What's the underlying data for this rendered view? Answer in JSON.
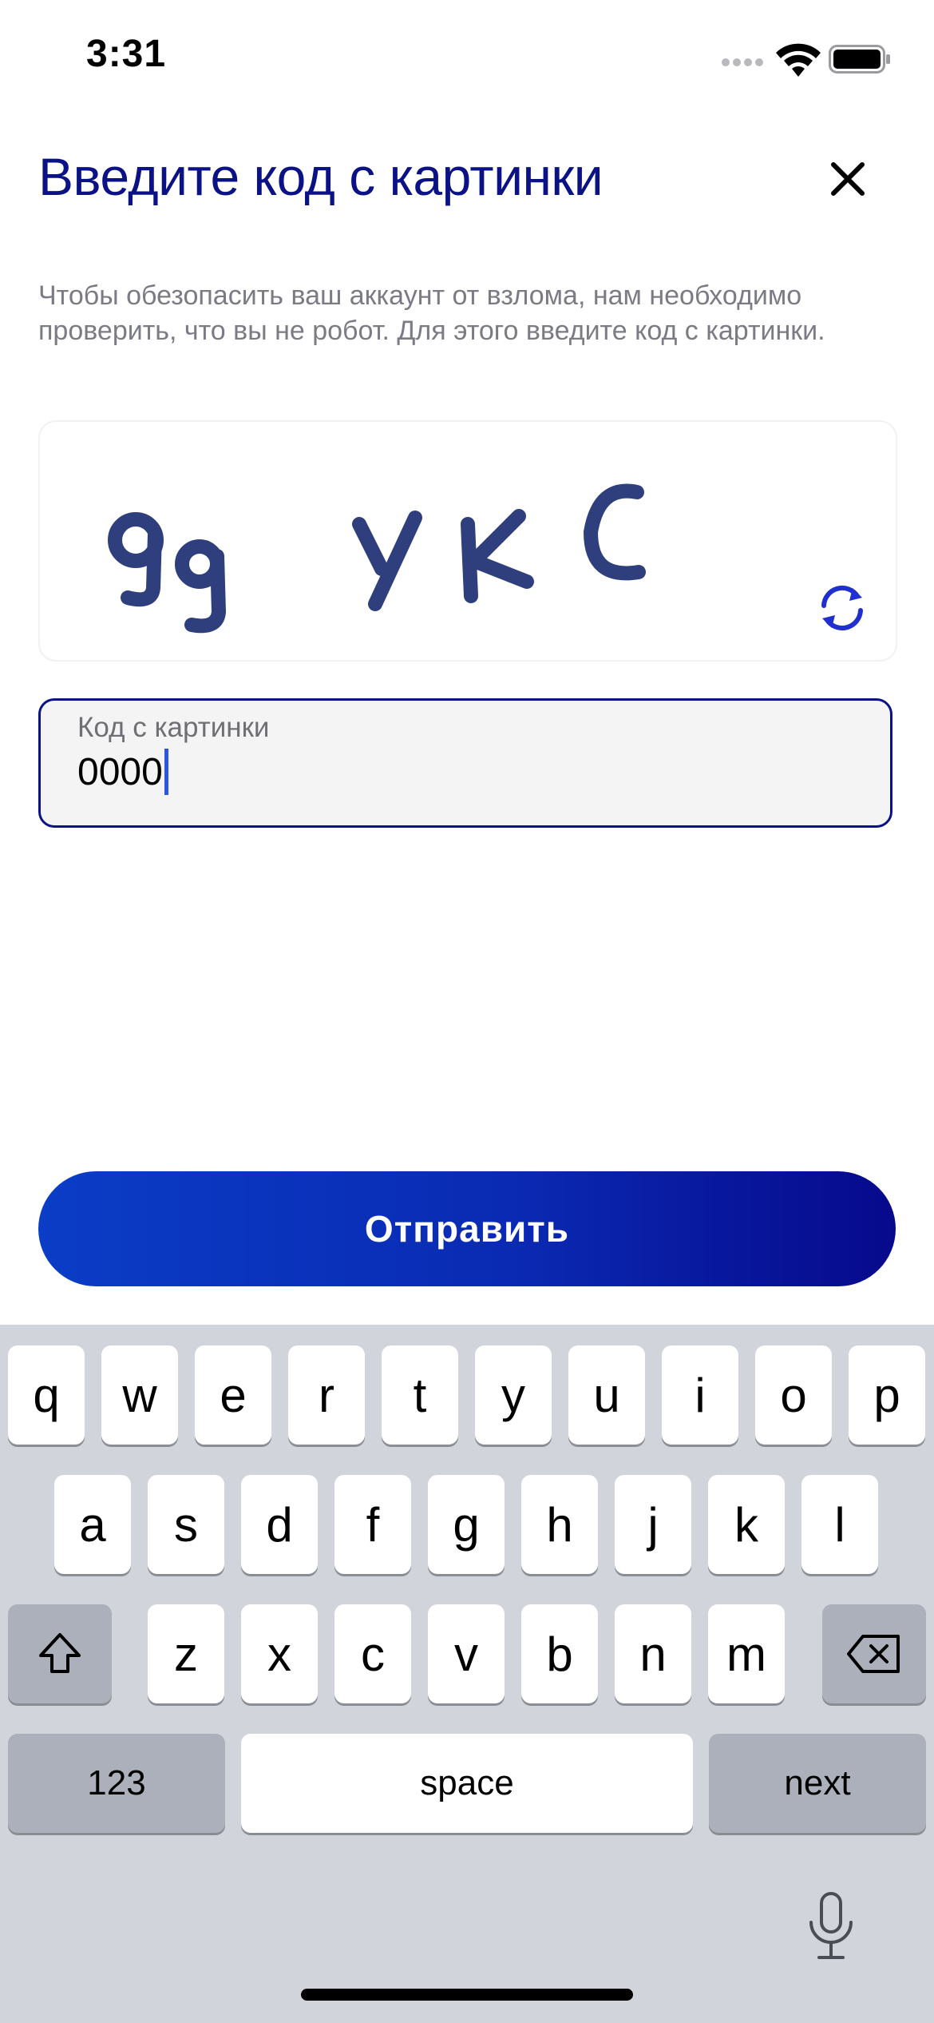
{
  "status_bar": {
    "time": "3:31"
  },
  "header": {
    "title": "Введите код с картинки"
  },
  "description": "Чтобы обезопасить ваш аккаунт от взлома, нам необходимо проверить, что вы не робот. Для этого введите код с картинки.",
  "captcha": {
    "text": "9g YKC"
  },
  "code_field": {
    "label": "Код с картинки",
    "value": "0000"
  },
  "submit": {
    "label": "Отправить"
  },
  "colors": {
    "accent": "#0b1285",
    "button_start": "#0b3dc6",
    "button_end": "#07098c",
    "keyboard_bg": "#d1d4da"
  },
  "keyboard": {
    "row1": [
      "q",
      "w",
      "e",
      "r",
      "t",
      "y",
      "u",
      "i",
      "o",
      "p"
    ],
    "row2": [
      "a",
      "s",
      "d",
      "f",
      "g",
      "h",
      "j",
      "k",
      "l"
    ],
    "row3": [
      "z",
      "x",
      "c",
      "v",
      "b",
      "n",
      "m"
    ],
    "numbers_label": "123",
    "space_label": "space",
    "next_label": "next"
  },
  "icons": [
    "close-icon",
    "refresh-icon",
    "shift-icon",
    "backspace-icon",
    "microphone-icon",
    "wifi-icon",
    "battery-icon"
  ]
}
